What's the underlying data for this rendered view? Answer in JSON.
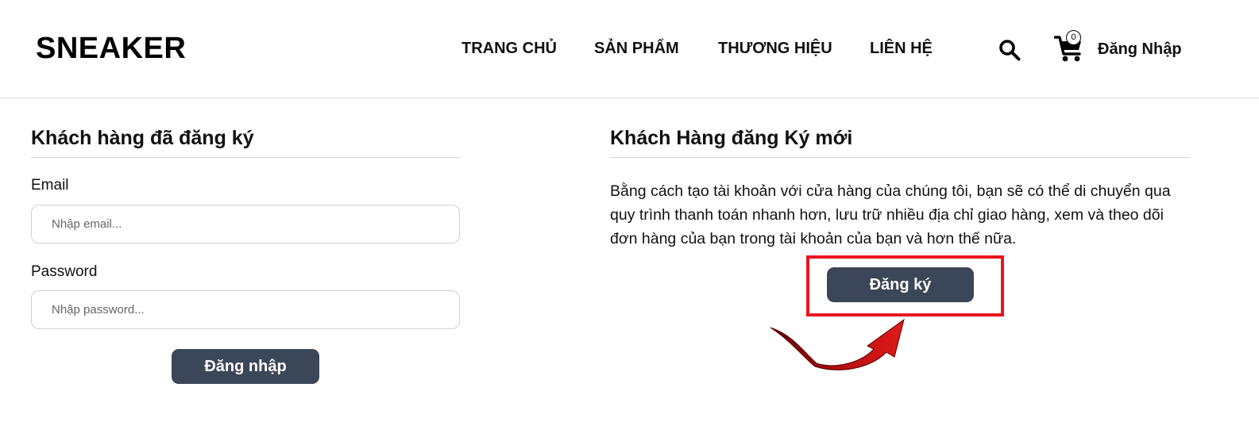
{
  "header": {
    "logo": "SNEAKER",
    "nav": [
      {
        "label": "TRANG CHỦ"
      },
      {
        "label": "SẢN PHẨM"
      },
      {
        "label": "THƯƠNG HIỆU"
      },
      {
        "label": "LIÊN HỆ"
      }
    ],
    "search_icon": "search-icon",
    "cart_icon": "cart-icon",
    "cart_count": "0",
    "login_label": "Đăng Nhập"
  },
  "login": {
    "title": "Khách hàng đã đăng ký",
    "email_label": "Email",
    "email_placeholder": "Nhập email...",
    "email_value": "",
    "password_label": "Password",
    "password_placeholder": "Nhập password...",
    "password_value": "",
    "submit_label": "Đăng nhập"
  },
  "register": {
    "title": "Khách Hàng đăng Ký mới",
    "description": "Bằng cách tạo tài khoản với cửa hàng của chúng tôi, bạn sẽ có thể di chuyển qua quy trình thanh toán nhanh hơn, lưu trữ nhiều địa chỉ giao hàng, xem và theo dõi đơn hàng của bạn trong tài khoản của bạn và hơn thế nữa.",
    "button_label": "Đăng ký"
  },
  "annotation": {
    "highlight_color": "#e8161c",
    "arrow_color": "#b80f10",
    "arrow_icon": "curved-arrow-icon"
  },
  "colors": {
    "button_bg": "#3b4658",
    "button_text": "#ffffff"
  }
}
